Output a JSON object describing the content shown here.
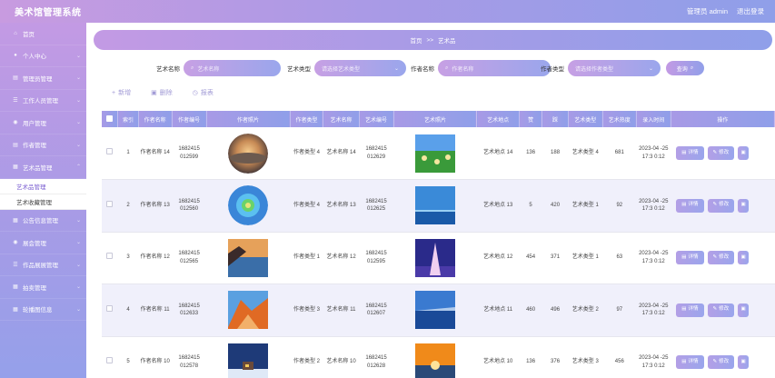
{
  "app": {
    "title": "美术馆管理系统",
    "user": "管理员 admin",
    "logout": "退出登录"
  },
  "sidebar": {
    "items": [
      {
        "label": "首页",
        "icon": "home-icon",
        "chev": false
      },
      {
        "label": "个人中心",
        "icon": "user-icon",
        "chev": true
      },
      {
        "label": "管理员管理",
        "icon": "list-icon",
        "chev": true
      },
      {
        "label": "工作人员管理",
        "icon": "list-icon",
        "chev": true
      },
      {
        "label": "用户管理",
        "icon": "location-icon",
        "chev": true
      },
      {
        "label": "作者管理",
        "icon": "list-icon",
        "chev": true
      },
      {
        "label": "艺术品管理",
        "icon": "grid-icon",
        "chev": true
      }
    ],
    "submenu": [
      {
        "label": "艺术品管理"
      },
      {
        "label": "艺术收藏管理"
      }
    ],
    "items_after": [
      {
        "label": "公告信息管理",
        "icon": "grid-icon",
        "chev": true
      },
      {
        "label": "展会管理",
        "icon": "location-icon",
        "chev": true
      },
      {
        "label": "作品展展管理",
        "icon": "list-icon",
        "chev": true
      },
      {
        "label": "拍卖管理",
        "icon": "grid-icon",
        "chev": true
      },
      {
        "label": "轮播图信息",
        "icon": "grid-icon",
        "chev": true
      }
    ]
  },
  "breadcrumb": {
    "home": "首页",
    "sep": ">>",
    "current": "艺术品"
  },
  "search": {
    "fields": [
      {
        "label": "艺术名称",
        "placeholder": "艺术名称"
      },
      {
        "label": "艺术类型",
        "placeholder": "请选择艺术类型"
      },
      {
        "label": "作者名称",
        "placeholder": "作者名称"
      },
      {
        "label": "作者类型",
        "placeholder": "请选择作者类型"
      }
    ],
    "button": "查询"
  },
  "actions": {
    "add": "新增",
    "delete": "删除",
    "report": "报表"
  },
  "table": {
    "headers": [
      "索引",
      "作者名称",
      "作者编号",
      "作者照片",
      "作者类型",
      "艺术名称",
      "艺术编号",
      "艺术照片",
      "艺术地点",
      "赞",
      "踩",
      "艺术类型",
      "艺术热度",
      "录入时间",
      "操作"
    ],
    "rows": [
      {
        "index": "1",
        "author_name": "作者名称 14",
        "author_no": "1682415 012599",
        "author_photo": "fisheye",
        "author_type": "作者类型 4",
        "art_name": "艺术名称 14",
        "art_no": "1682415 012629",
        "art_photo": "flowers",
        "location": "艺术地点 14",
        "likes": "136",
        "dislikes": "188",
        "art_type": "艺术类型 4",
        "heat": "681",
        "time": "2023-04 -25 17:3 0:12"
      },
      {
        "index": "2",
        "author_name": "作者名称 13",
        "author_no": "1682415 012560",
        "author_photo": "globe",
        "author_type": "作者类型 4",
        "art_name": "艺术名称 13",
        "art_no": "1682415 012625",
        "art_photo": "sea",
        "location": "艺术地点 13",
        "likes": "5",
        "dislikes": "420",
        "art_type": "艺术类型 1",
        "heat": "92",
        "time": "2023-04 -25 17:3 0:12"
      },
      {
        "index": "3",
        "author_name": "作者名称 12",
        "author_no": "1682415 012565",
        "author_photo": "coast",
        "author_type": "作者类型 1",
        "art_name": "艺术名称 12",
        "art_no": "1682415 012595",
        "art_photo": "eiffel",
        "location": "艺术地点 12",
        "likes": "454",
        "dislikes": "371",
        "art_type": "艺术类型 1",
        "heat": "63",
        "time": "2023-04 -25 17:3 0:12"
      },
      {
        "index": "4",
        "author_name": "作者名称 11",
        "author_no": "1682415 012633",
        "author_photo": "mountain",
        "author_type": "作者类型 3",
        "art_name": "艺术名称 11",
        "art_no": "1682415 012607",
        "art_photo": "ocean",
        "location": "艺术地点 11",
        "likes": "460",
        "dislikes": "496",
        "art_type": "艺术类型 2",
        "heat": "97",
        "time": "2023-04 -25 17:3 0:12"
      },
      {
        "index": "5",
        "author_name": "作者名称 10",
        "author_no": "1682415 012578",
        "author_photo": "snowhouse",
        "author_type": "作者类型 2",
        "art_name": "艺术名称 10",
        "art_no": "1682415 012628",
        "art_photo": "sunset",
        "location": "艺术地点 10",
        "likes": "136",
        "dislikes": "376",
        "art_type": "艺术类型 3",
        "heat": "456",
        "time": "2023-04 -25 17:3 0:12"
      }
    ],
    "ops": {
      "detail": "详情",
      "edit": "修改"
    }
  }
}
